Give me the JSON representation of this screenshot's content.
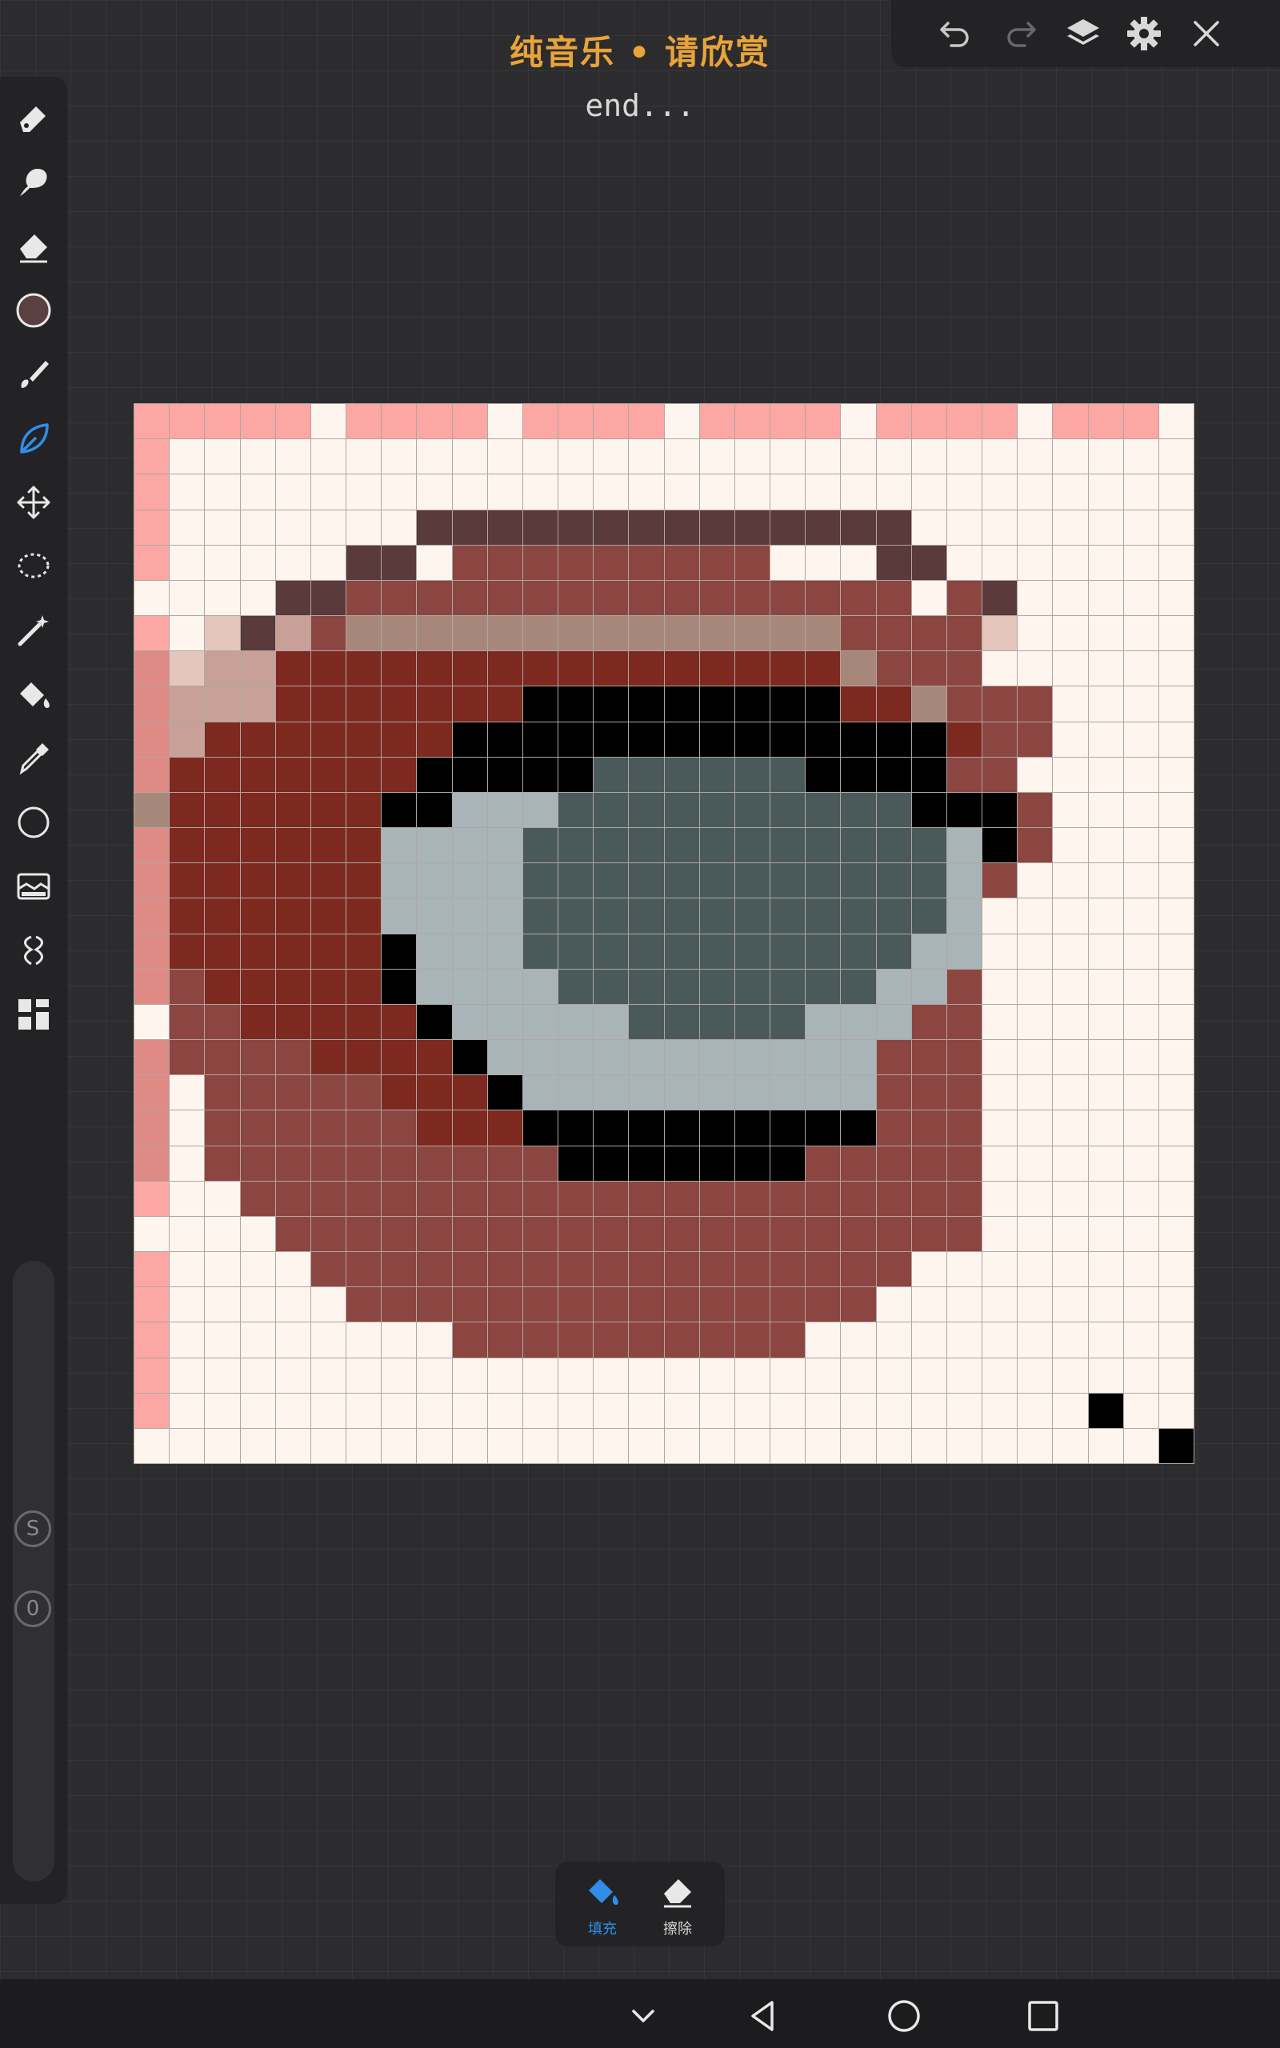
{
  "header": {
    "title": "纯音乐 • 请欣赏",
    "subtitle": "end..."
  },
  "top_toolbar": {
    "icons": [
      "undo-icon",
      "redo-icon",
      "layers-icon",
      "gear-icon",
      "close-icon"
    ]
  },
  "left_toolbar": {
    "tools": [
      "pen-icon",
      "smudge-icon",
      "eraser-icon",
      "color-swatch",
      "brush-icon",
      "leaf-icon",
      "move-icon",
      "lasso-icon",
      "magic-wand-icon",
      "bucket-icon",
      "eyedropper-icon",
      "circle-icon",
      "image-adjust-icon",
      "mirror-icon",
      "grid-icon"
    ],
    "active_tool": "leaf-icon",
    "current_color": "#5a4040",
    "slider": {
      "badge_s": "S",
      "badge_value": "0"
    }
  },
  "canvas": {
    "palette": {
      "W": "#fff5ef",
      "p": "#fca7a4",
      "P": "#e08a86",
      "D": "#5a3a3a",
      "R": "#8b4641",
      "r": "#7d2920",
      "t": "#a8877b",
      "l": "#e4c6bc",
      "m": "#c8a098",
      "K": "#000000",
      "G": "#4a5a5a",
      "g": "#a8b4b8"
    },
    "rows": [
      "pppppWppppWppppWppppWppppWpppW",
      "pWWWWWWWWWWWWWWWWWWWWWWWWWWWWW",
      "pWWWWWWWWWWWWWWWWWWWWWWWWWWWWW",
      "pWWWWWWWDDDDDDDDDDDDDDWWWWWWWW",
      "pWWWWWDDWRRRRRRRRRWWWDDWWWWWWW",
      "WWWWDDRRRRRRRRRRRRRRRRWRDWWWWW",
      "pWlDmRttttttttttttttRRRRlWWWWW",
      "PlmmrrrrrrrrrrrrrrrrtRRRWWWWWW",
      "Pmmmrrrrrrr KKKKKKKKrrtRRRWWWW",
      "Pmrrrrrrr KKKKKKKKKKKKKrRRWWWW",
      "PrrrrrrrKKKKKGGGGGGKKKKRRWWWWW",
      "trrrrrrKKgggGGGGGGGGGGKKKRWWWW",
      "PrrrrrrggggGGGGGGGGGGGGgKRWWWW",
      "PrrrrrrggggGGGGGGGGGGGGgRWWWWW",
      "PrrrrrrggggGGGGGGGGGGGGgWWWWWW",
      "PrrrrrrKgggGGGGGGGGGGGggWWWWWW",
      "PRrrrrrKggggGGGGGGGGGggRWWWWWW",
      "WRRrrrrrKgggggGGGGGgggRRWWWWWW",
      "PRRRRrrrrKgggggggggggRRRWWWWWW",
      "PWRRRRRrrrKggggggggggRRRWWWWWW",
      "PWRRRRRRrrrKKKKKKKKKKRRRWWWWWW",
      "PWRRRRRRRRRRKKKKKKKRRRRRWWWWWW",
      "pWWRRRRRRRRRRRRRRRRRRRRRWWWWWW",
      "WWWWRRRRRRRRRRRRRRRRRRRRWWWWWW",
      "pWWWWRRRRRRRRRRRRRRRRRWWWWWWWW",
      "pWWWWWRRRRRRRRRRRRRRRWWWWWWWWW",
      "pWWWWWWWWRRRRRRRRRRWWWWWWWWWWW",
      "pWWWWWWWWWWWWWWWWWWWWWWWWWWWWW",
      "pWWWWWWWWWWWWWWWWWWWWWWWWWWKWW",
      "WWWWWWWWWWWWWWWWWWWWWWWWWWWWWK"
    ]
  },
  "bottom_tools": {
    "fill": {
      "label": "填充",
      "icon": "bucket-fill-icon",
      "color": "#2f8fe8"
    },
    "erase": {
      "label": "擦除",
      "icon": "eraser-icon",
      "color": "#d8d8d8"
    }
  },
  "nav_bar": {
    "icons": [
      "chevron-down-icon",
      "back-icon",
      "home-icon",
      "recents-icon"
    ]
  }
}
